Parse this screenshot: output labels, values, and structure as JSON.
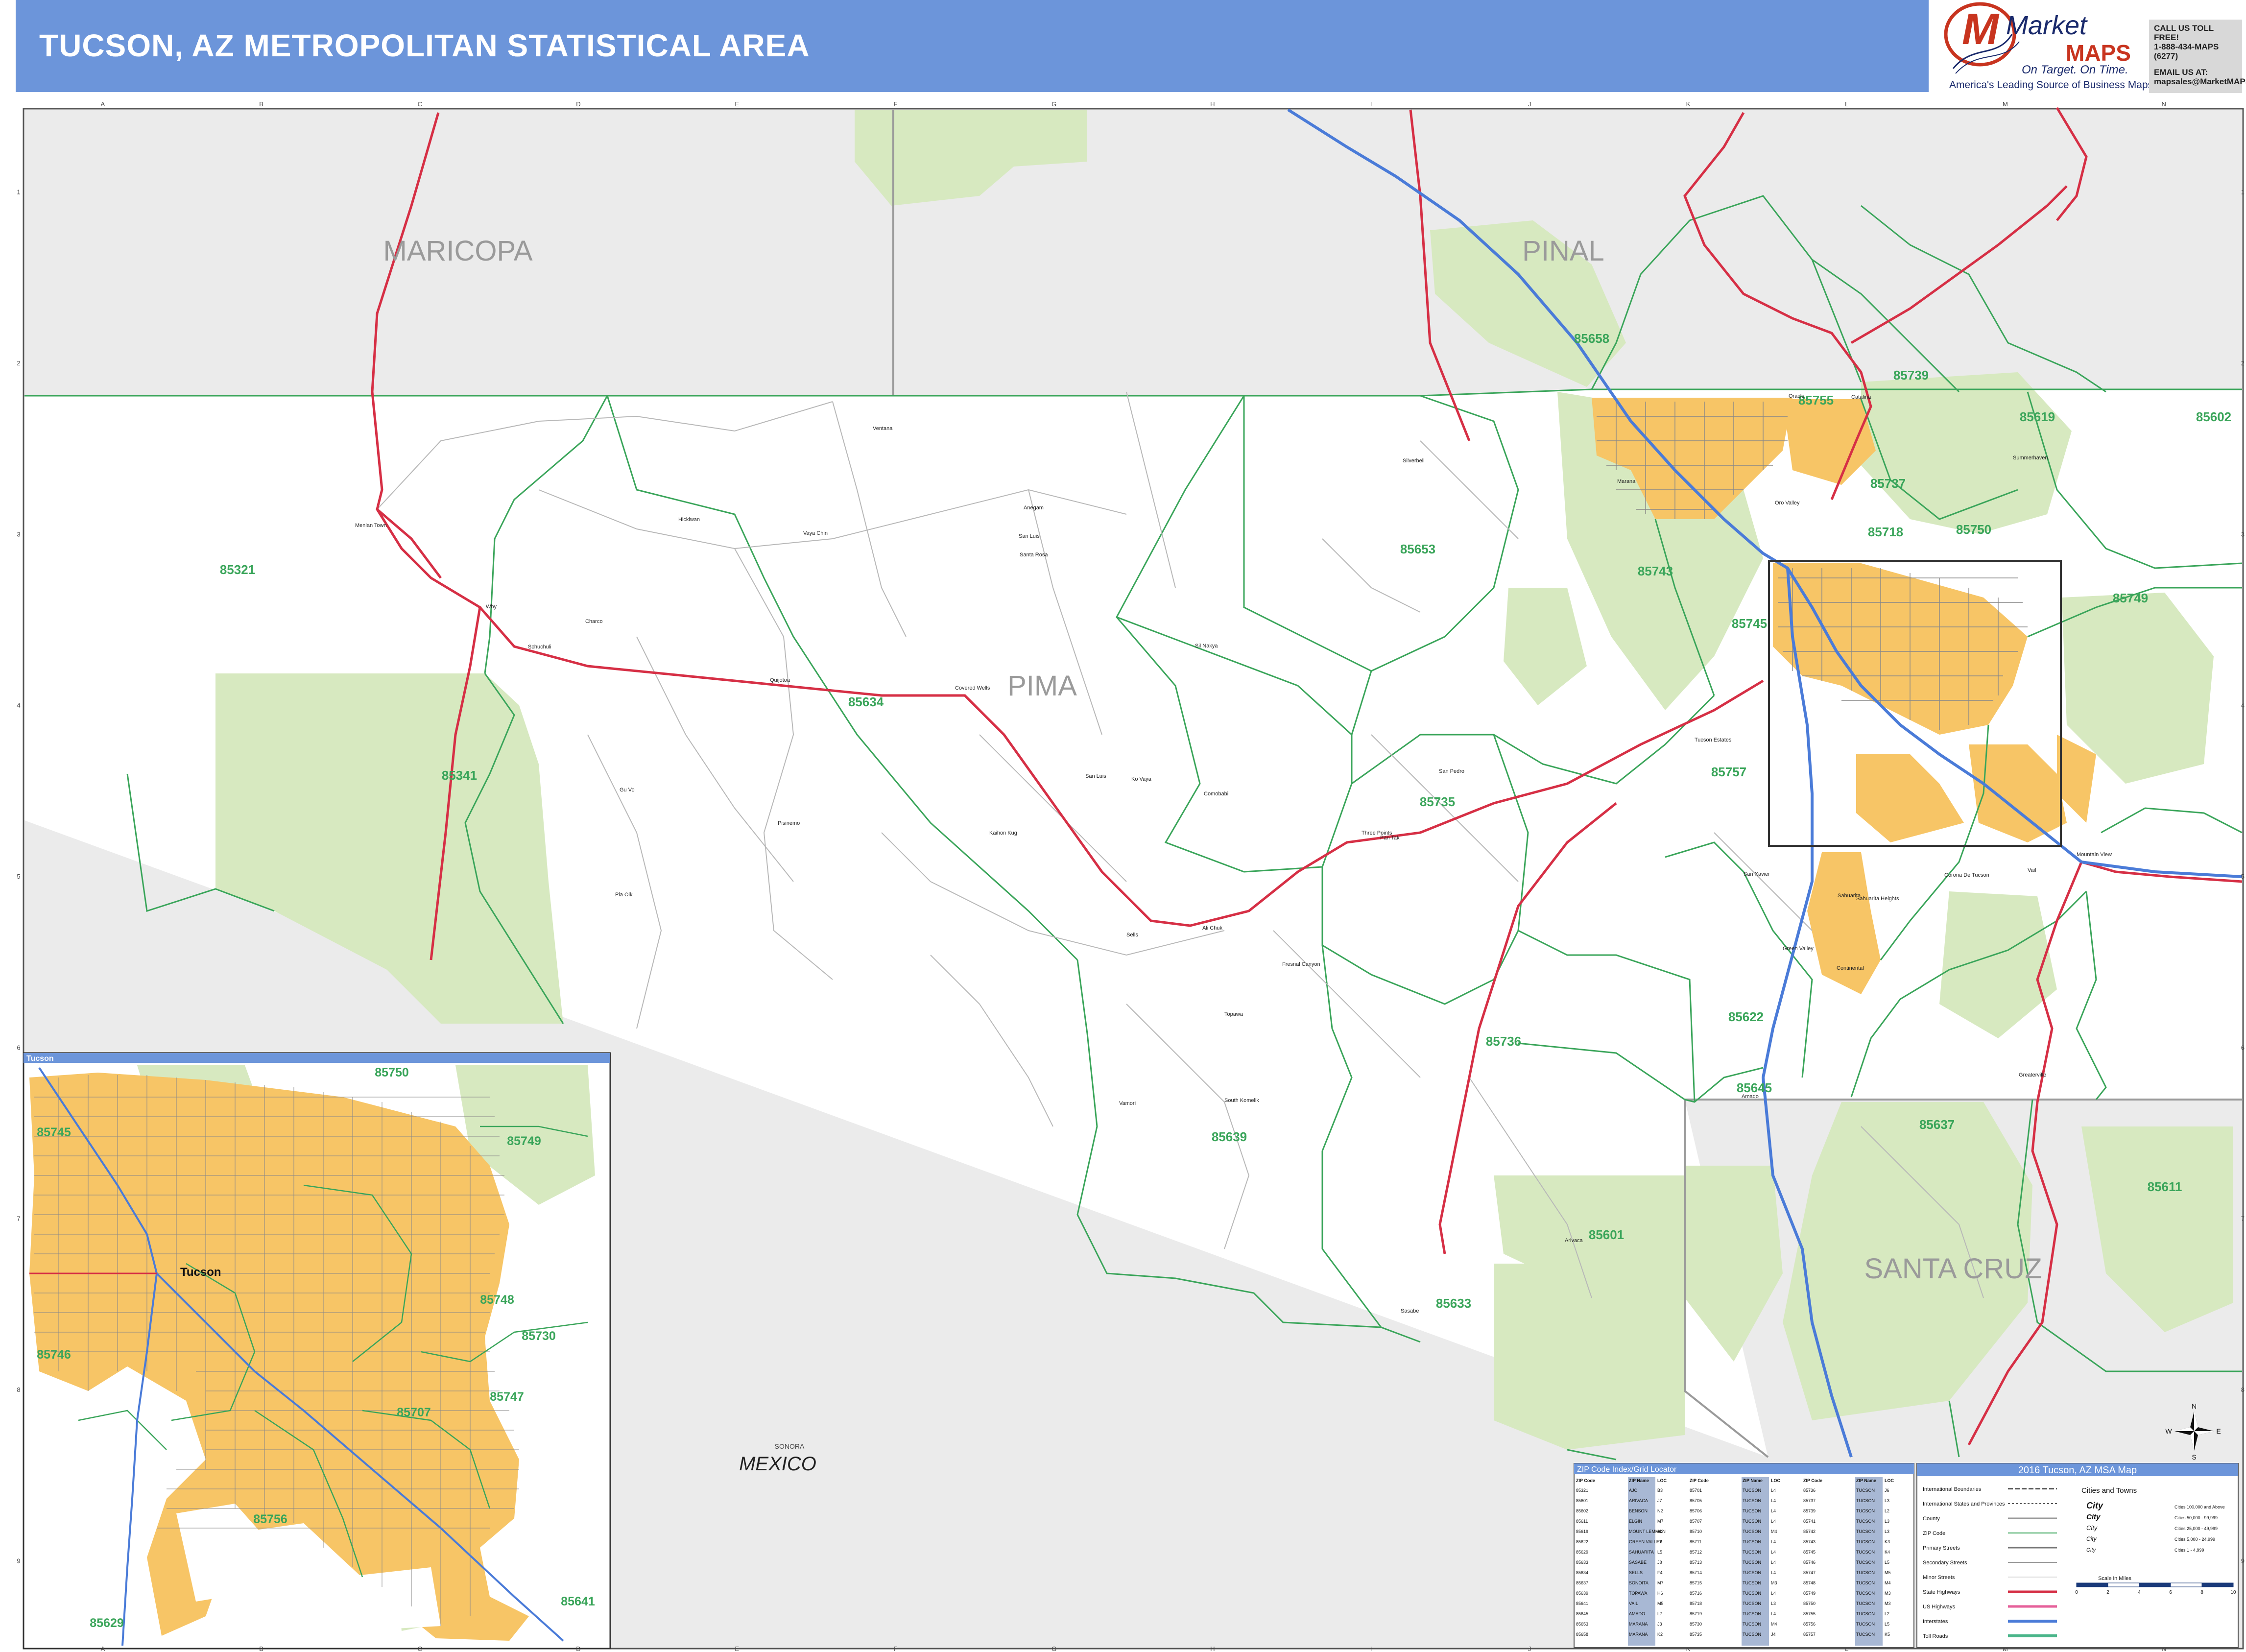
{
  "header": {
    "title": "TUCSON, AZ METROPOLITAN STATISTICAL AREA",
    "brand_name_a": "Market",
    "brand_name_b": "MAPS",
    "brand_slogan": "On Target. On Time.",
    "brand_tagline": "America's Leading Source of Business Maps",
    "contact_line1": "CALL US TOLL FREE!",
    "contact_line2": "1-888-434-MAPS (6277)",
    "contact_line3": "EMAIL US AT:",
    "contact_line4": "mapsales@MarketMAPS.com",
    "accent_color": "#6c95da",
    "logo_color": "#c8341f"
  },
  "grid": {
    "columns": [
      "A",
      "B",
      "C",
      "D",
      "E",
      "F",
      "G",
      "H",
      "I",
      "J",
      "K",
      "L",
      "M",
      "N"
    ],
    "rows": [
      "1",
      "2",
      "3",
      "4",
      "5",
      "6",
      "7",
      "8",
      "9"
    ]
  },
  "colors": {
    "urban": "#f7c566",
    "public_land": "#d7e9c0",
    "outside": "#ebebeb",
    "zip_line": "#3aa55a",
    "highway": "#d62f45",
    "interstate": "#4a7bd8"
  },
  "map": {
    "counties": [
      "MARICOPA",
      "PINAL",
      "PIMA",
      "SANTA CRUZ"
    ],
    "country": "MEXICO",
    "state_label": "SONORA",
    "zips": [
      {
        "code": "85321"
      },
      {
        "code": "85341"
      },
      {
        "code": "85634"
      },
      {
        "code": "85653"
      },
      {
        "code": "85735"
      },
      {
        "code": "85736"
      },
      {
        "code": "85639"
      },
      {
        "code": "85633"
      },
      {
        "code": "85601"
      },
      {
        "code": "85622"
      },
      {
        "code": "85645"
      },
      {
        "code": "85637"
      },
      {
        "code": "85611"
      },
      {
        "code": "85749"
      },
      {
        "code": "85750"
      },
      {
        "code": "85718"
      },
      {
        "code": "85737"
      },
      {
        "code": "85739"
      },
      {
        "code": "85755"
      },
      {
        "code": "85658"
      },
      {
        "code": "85619"
      },
      {
        "code": "85602"
      },
      {
        "code": "85757"
      },
      {
        "code": "85743"
      },
      {
        "code": "85745"
      }
    ],
    "places": [
      {
        "name": "Ventana"
      },
      {
        "name": "Menlan Town"
      },
      {
        "name": "Why"
      },
      {
        "name": "Schuchuli"
      },
      {
        "name": "Charco"
      },
      {
        "name": "Hickiwan"
      },
      {
        "name": "Santa Rosa"
      },
      {
        "name": "Vaya Chin"
      },
      {
        "name": "Anegam"
      },
      {
        "name": "San Luis"
      },
      {
        "name": "Sil Nakya"
      },
      {
        "name": "Covered Wells"
      },
      {
        "name": "Quijotoa"
      },
      {
        "name": "San Luis"
      },
      {
        "name": "Ko Vaya"
      },
      {
        "name": "Comobabi"
      },
      {
        "name": "Pisinemo"
      },
      {
        "name": "Kaihon Kug"
      },
      {
        "name": "Gu Vo"
      },
      {
        "name": "Pia Oik"
      },
      {
        "name": "Sells"
      },
      {
        "name": "Topawa"
      },
      {
        "name": "Ali Chuk"
      },
      {
        "name": "Fresnal Canyon"
      },
      {
        "name": "South Komelik"
      },
      {
        "name": "Vamori"
      },
      {
        "name": "Sasabe"
      },
      {
        "name": "Arivaca"
      },
      {
        "name": "Three Points"
      },
      {
        "name": "Pan Tak"
      },
      {
        "name": "San Pedro"
      },
      {
        "name": "Silverbell"
      },
      {
        "name": "Marana"
      },
      {
        "name": "Catalina"
      },
      {
        "name": "Oracle"
      },
      {
        "name": "Summerhaven"
      },
      {
        "name": "Oro Valley"
      },
      {
        "name": "Tucson Estates"
      },
      {
        "name": "Sahuarita"
      },
      {
        "name": "Green Valley"
      },
      {
        "name": "Continental"
      },
      {
        "name": "Amado"
      },
      {
        "name": "Corona De Tucson"
      },
      {
        "name": "Vail"
      },
      {
        "name": "Greaterville"
      },
      {
        "name": "Mountain View"
      },
      {
        "name": "San Xavier"
      },
      {
        "name": "Sahuarita Heights"
      }
    ]
  },
  "inset": {
    "title": "Tucson",
    "city_label": "Tucson",
    "zips": [
      {
        "code": "85750"
      },
      {
        "code": "85745"
      },
      {
        "code": "85749"
      },
      {
        "code": "85748"
      },
      {
        "code": "85730"
      },
      {
        "code": "85746"
      },
      {
        "code": "85747"
      },
      {
        "code": "85707"
      },
      {
        "code": "85756"
      },
      {
        "code": "85641"
      },
      {
        "code": "85629"
      }
    ]
  },
  "zip_index": {
    "title": "ZIP Code Index/Grid Locator",
    "headers": [
      "ZIP Code",
      "ZIP Name",
      "LOC"
    ],
    "entries": [
      {
        "zip": "85321",
        "name": "AJO",
        "loc": "B3"
      },
      {
        "zip": "85601",
        "name": "ARIVACA",
        "loc": "J7"
      },
      {
        "zip": "85602",
        "name": "BENSON",
        "loc": "N2"
      },
      {
        "zip": "85611",
        "name": "ELGIN",
        "loc": "M7"
      },
      {
        "zip": "85619",
        "name": "MOUNT LEMMON",
        "loc": "M2"
      },
      {
        "zip": "85622",
        "name": "GREEN VALLEY",
        "loc": "L6"
      },
      {
        "zip": "85629",
        "name": "SAHUARITA",
        "loc": "L5"
      },
      {
        "zip": "85633",
        "name": "SASABE",
        "loc": "J8"
      },
      {
        "zip": "85634",
        "name": "SELLS",
        "loc": "F4"
      },
      {
        "zip": "85637",
        "name": "SONOITA",
        "loc": "M7"
      },
      {
        "zip": "85639",
        "name": "TOPAWA",
        "loc": "H6"
      },
      {
        "zip": "85641",
        "name": "VAIL",
        "loc": "M5"
      },
      {
        "zip": "85645",
        "name": "AMADO",
        "loc": "L7"
      },
      {
        "zip": "85653",
        "name": "MARANA",
        "loc": "J3"
      },
      {
        "zip": "85658",
        "name": "MARANA",
        "loc": "K2"
      },
      {
        "zip": "85701",
        "name": "TUCSON",
        "loc": "L4"
      },
      {
        "zip": "85705",
        "name": "TUCSON",
        "loc": "L4"
      },
      {
        "zip": "85706",
        "name": "TUCSON",
        "loc": "L4"
      },
      {
        "zip": "85707",
        "name": "TUCSON",
        "loc": "L4"
      },
      {
        "zip": "85710",
        "name": "TUCSON",
        "loc": "M4"
      },
      {
        "zip": "85711",
        "name": "TUCSON",
        "loc": "L4"
      },
      {
        "zip": "85712",
        "name": "TUCSON",
        "loc": "L4"
      },
      {
        "zip": "85713",
        "name": "TUCSON",
        "loc": "L4"
      },
      {
        "zip": "85714",
        "name": "TUCSON",
        "loc": "L4"
      },
      {
        "zip": "85715",
        "name": "TUCSON",
        "loc": "M3"
      },
      {
        "zip": "85716",
        "name": "TUCSON",
        "loc": "L4"
      },
      {
        "zip": "85718",
        "name": "TUCSON",
        "loc": "L3"
      },
      {
        "zip": "85719",
        "name": "TUCSON",
        "loc": "L4"
      },
      {
        "zip": "85730",
        "name": "TUCSON",
        "loc": "M4"
      },
      {
        "zip": "85735",
        "name": "TUCSON",
        "loc": "J4"
      },
      {
        "zip": "85736",
        "name": "TUCSON",
        "loc": "J6"
      },
      {
        "zip": "85737",
        "name": "TUCSON",
        "loc": "L3"
      },
      {
        "zip": "85739",
        "name": "TUCSON",
        "loc": "L2"
      },
      {
        "zip": "85741",
        "name": "TUCSON",
        "loc": "L3"
      },
      {
        "zip": "85742",
        "name": "TUCSON",
        "loc": "L3"
      },
      {
        "zip": "85743",
        "name": "TUCSON",
        "loc": "K3"
      },
      {
        "zip": "85745",
        "name": "TUCSON",
        "loc": "K4"
      },
      {
        "zip": "85746",
        "name": "TUCSON",
        "loc": "L5"
      },
      {
        "zip": "85747",
        "name": "TUCSON",
        "loc": "M5"
      },
      {
        "zip": "85748",
        "name": "TUCSON",
        "loc": "M4"
      },
      {
        "zip": "85749",
        "name": "TUCSON",
        "loc": "M3"
      },
      {
        "zip": "85750",
        "name": "TUCSON",
        "loc": "M3"
      },
      {
        "zip": "85755",
        "name": "TUCSON",
        "loc": "L2"
      },
      {
        "zip": "85756",
        "name": "TUCSON",
        "loc": "L5"
      },
      {
        "zip": "85757",
        "name": "TUCSON",
        "loc": "K5"
      }
    ]
  },
  "legend": {
    "title": "2016 Tucson, AZ MSA Map",
    "items": [
      {
        "label": "International Boundaries"
      },
      {
        "label": "International States and Provinces"
      },
      {
        "label": "County"
      },
      {
        "label": "ZIP Code"
      },
      {
        "label": "Primary Streets"
      },
      {
        "label": "Secondary Streets"
      },
      {
        "label": "Minor Streets"
      },
      {
        "label": "State Highways"
      },
      {
        "label": "US Highways"
      },
      {
        "label": "Interstates"
      },
      {
        "label": "Toll Roads"
      }
    ],
    "cities_header": "Cities and Towns",
    "city_levels": [
      {
        "label": "City",
        "pop": "Cities 100,000 and Above"
      },
      {
        "label": "City",
        "pop": "Cities 50,000 - 99,999"
      },
      {
        "label": "City",
        "pop": "Cities 25,000 - 49,999"
      },
      {
        "label": "City",
        "pop": "Cities 5,000 - 24,999"
      },
      {
        "label": "City",
        "pop": "Cities 1 - 4,999"
      }
    ],
    "scale_label": "Scale in Miles",
    "scale_ticks": [
      "0",
      "2",
      "4",
      "6",
      "8",
      "10"
    ]
  },
  "compass": {
    "n": "N",
    "e": "E",
    "s": "S",
    "w": "W"
  }
}
